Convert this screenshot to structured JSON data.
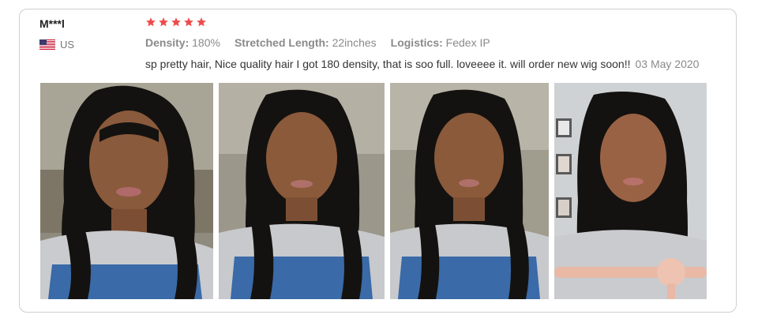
{
  "review": {
    "username": "M***l",
    "country": "US",
    "flag_icon": "us-flag-icon",
    "rating": 5,
    "star_color": "#f04b4b",
    "specs": [
      {
        "key": "Density:",
        "value": "180%"
      },
      {
        "key": "Stretched Length:",
        "value": "22inches"
      },
      {
        "key": "Logistics:",
        "value": "Fedex IP"
      }
    ],
    "comment": "sp pretty hair, Nice quality hair I got 180 density, that is soo full. loveeee it. will order new wig soon!!",
    "date": "03 May 2020",
    "photos": [
      {
        "label": "review-photo-1"
      },
      {
        "label": "review-photo-2"
      },
      {
        "label": "review-photo-3"
      },
      {
        "label": "review-photo-4"
      }
    ]
  }
}
